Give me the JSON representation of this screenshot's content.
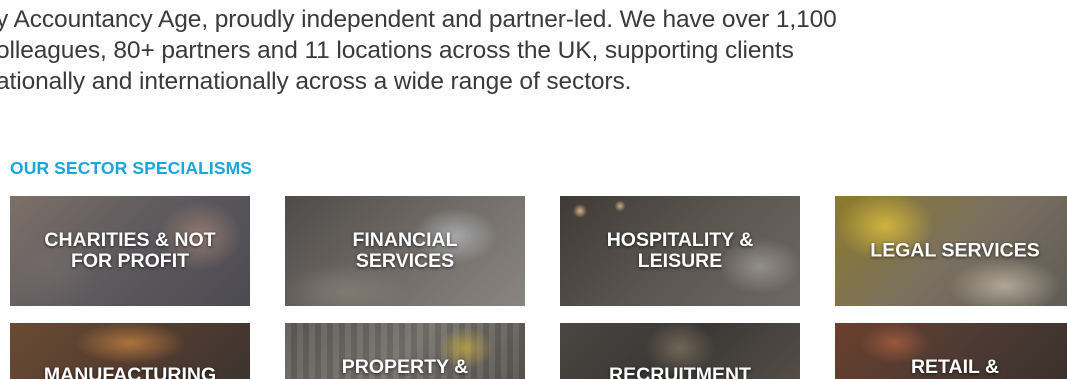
{
  "intro": {
    "lines": [
      "y Accountancy Age, proudly independent and partner-led. We have over 1,100",
      "olleagues, 80+ partners and 11 locations across the UK, supporting clients",
      "ationally and internationally across a wide range of sectors."
    ]
  },
  "sectors": {
    "heading": "OUR SECTOR SPECIALISMS",
    "tiles": [
      {
        "label": "CHARITIES & NOT\nFOR PROFIT"
      },
      {
        "label": "FINANCIAL\nSERVICES"
      },
      {
        "label": "HOSPITALITY &\nLEISURE"
      },
      {
        "label": "LEGAL SERVICES"
      },
      {
        "label": "MANUFACTURING"
      },
      {
        "label": "PROPERTY &"
      },
      {
        "label": "RECRUITMENT"
      },
      {
        "label": "RETAIL &"
      }
    ]
  }
}
